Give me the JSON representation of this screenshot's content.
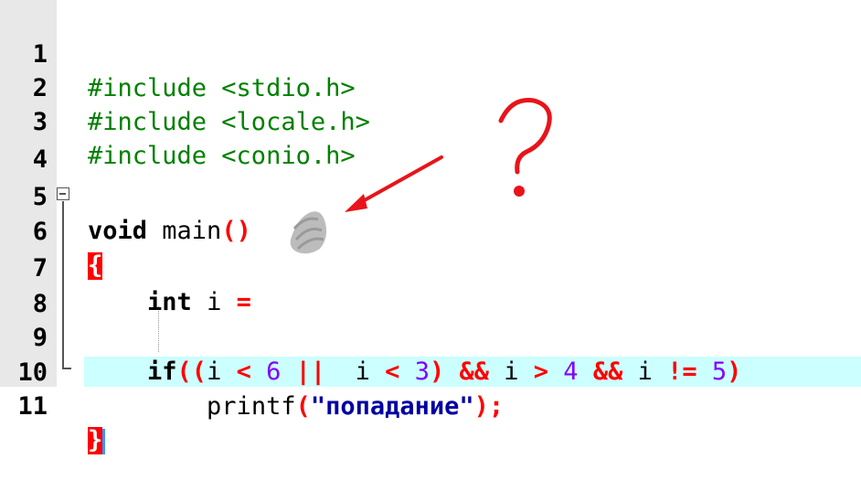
{
  "editor": {
    "lines": [
      {
        "num": "1",
        "pp": "#include <stdio.h>"
      },
      {
        "num": "2",
        "pp": "#include <locale.h>"
      },
      {
        "num": "3",
        "pp": "#include <conio.h>"
      },
      {
        "num": "4"
      },
      {
        "num": "5",
        "kw": "void",
        "rest": " main",
        "paren": "()"
      },
      {
        "num": "6",
        "brace": "{"
      },
      {
        "num": "7",
        "indent": "    ",
        "kw": "int",
        "rest": " i ",
        "op": "=",
        "tail": " "
      },
      {
        "num": "8"
      },
      {
        "num": "9",
        "indent": "    ",
        "kw": "if",
        "p1": "((",
        "v1": "i ",
        "o1": "<",
        "n1": " 6 ",
        "o2": "||",
        "v2": "  i ",
        "o3": "<",
        "n2": " 3",
        "p2": ")",
        "o4": " &&",
        "v3": " i ",
        "o5": ">",
        "n3": " 4",
        "o6": " &&",
        "v4": " i ",
        "o7": "!=",
        "n4": " 5",
        "p3": ")"
      },
      {
        "num": "10",
        "indent": "        ",
        "fn": "printf",
        "p1": "(",
        "str": "\"попадание\"",
        "p2": ");"
      },
      {
        "num": "11",
        "brace": "}"
      }
    ]
  },
  "colors": {
    "preprocessor": "#008000",
    "operator": "#ff0000",
    "number": "#8000ff",
    "string": "#0000a0",
    "gutter": "#e8e8e8",
    "current_line": "#ccffff",
    "annotation": "#e8141a"
  },
  "annotation": {
    "question_mark": "?",
    "arrow": "red-arrow-icon",
    "smudge": "gray-scribble"
  }
}
